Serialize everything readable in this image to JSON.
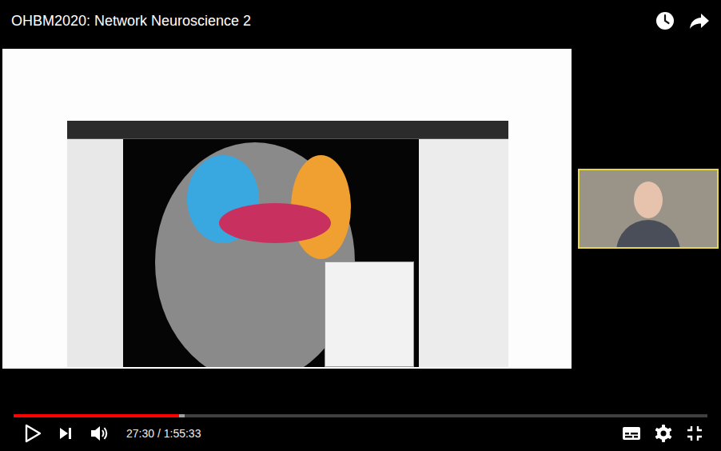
{
  "title": "OHBM2020: Network Neuroscience 2",
  "progress": {
    "level": 0.238,
    "buffered": 0.246
  },
  "time": "27:30 / 1:55:33"
}
